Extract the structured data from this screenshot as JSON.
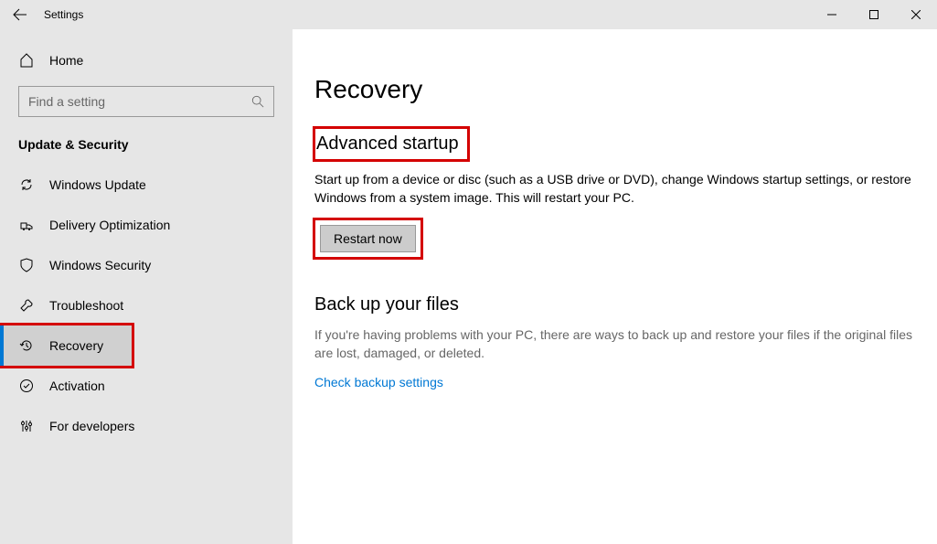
{
  "window": {
    "title": "Settings"
  },
  "sidebar": {
    "home_label": "Home",
    "search_placeholder": "Find a setting",
    "category": "Update & Security",
    "items": [
      {
        "label": "Windows Update"
      },
      {
        "label": "Delivery Optimization"
      },
      {
        "label": "Windows Security"
      },
      {
        "label": "Troubleshoot"
      },
      {
        "label": "Recovery"
      },
      {
        "label": "Activation"
      },
      {
        "label": "For developers"
      }
    ]
  },
  "content": {
    "page_title": "Recovery",
    "advanced": {
      "title": "Advanced startup",
      "description": "Start up from a device or disc (such as a USB drive or DVD), change Windows startup settings, or restore Windows from a system image. This will restart your PC.",
      "button": "Restart now"
    },
    "backup": {
      "title": "Back up your files",
      "description": "If you're having problems with your PC, there are ways to back up and restore your files if the original files are lost, damaged, or deleted.",
      "link": "Check backup settings"
    }
  }
}
